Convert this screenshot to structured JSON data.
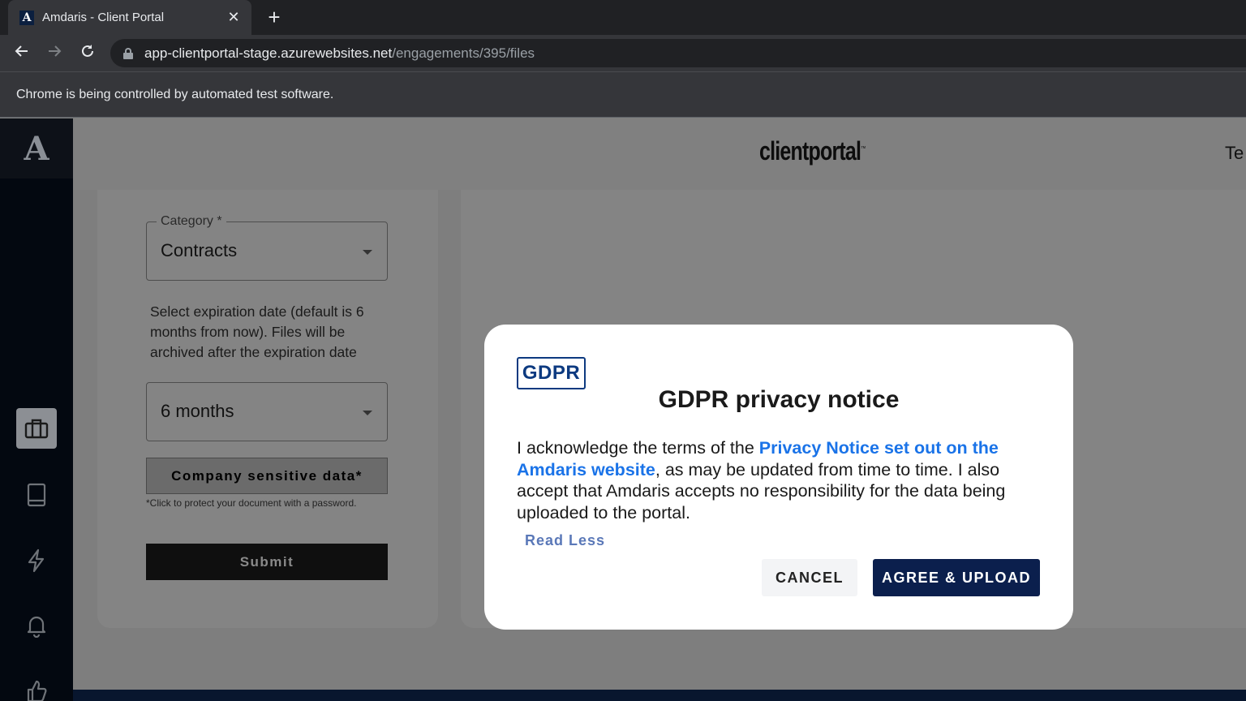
{
  "browser": {
    "tab_title": "Amdaris - Client Portal",
    "favicon_letter": "A",
    "url_host": "app-clientportal-stage.azurewebsites.net",
    "url_path": "/engagements/395/files",
    "infobar_text": "Chrome is being controlled by automated test software."
  },
  "app": {
    "brand": "clientportal",
    "brand_tm": "™",
    "header_user": "Te",
    "sidebar": {
      "logo_letter": "A",
      "items": [
        {
          "icon": "briefcase-icon",
          "active": true
        },
        {
          "icon": "book-icon",
          "active": false
        },
        {
          "icon": "lightning-icon",
          "active": false
        },
        {
          "icon": "bell-icon",
          "active": false
        },
        {
          "icon": "thumbs-up-icon",
          "active": false
        }
      ]
    }
  },
  "form": {
    "category_label": "Category *",
    "category_value": "Contracts",
    "expiration_help": "Select expiration date (default is 6 months from now). Files will be archived after the expiration date",
    "expiration_value": "6 months",
    "sensitive_button": "Company sensitive data*",
    "sensitive_note": "*Click to protect your document with a password.",
    "submit_button": "Submit"
  },
  "modal": {
    "badge": "GDPR",
    "title": "GDPR privacy notice",
    "body_pre": "I acknowledge the terms of the ",
    "body_link": "Privacy Notice set out on the Amdaris website",
    "body_post": ", as may be updated from time to time. I also accept that Amdaris accepts no responsibility for the data being uploaded to the portal.",
    "read_less": "Read Less",
    "cancel_button": "CANCEL",
    "agree_button": "AGREE & UPLOAD"
  },
  "colors": {
    "overlay": "#808080",
    "sidebar": "#030810",
    "primary_button": "#0b1f4d",
    "link": "#1a73e8"
  }
}
